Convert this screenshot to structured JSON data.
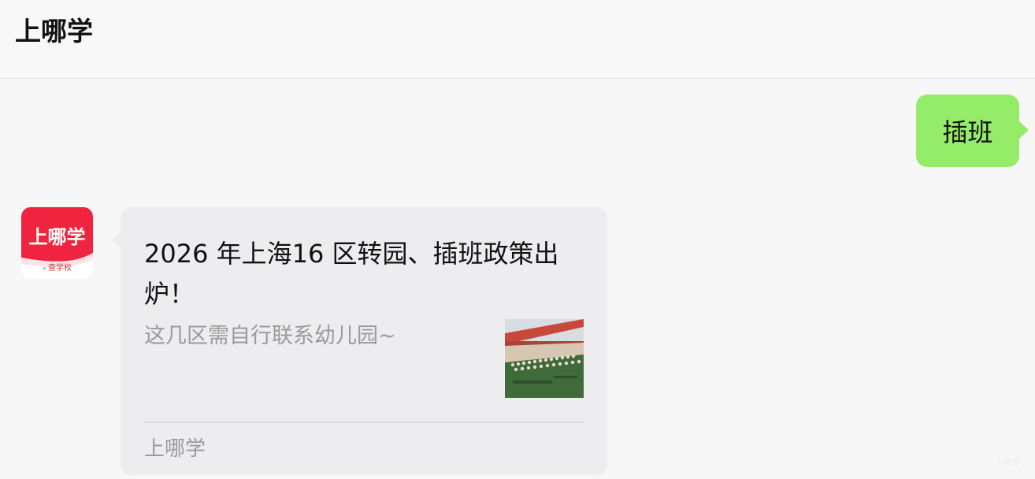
{
  "header": {
    "title": "上哪学"
  },
  "chat": {
    "outgoing": {
      "text": "插班",
      "bubble_color": "#95ec69"
    },
    "incoming": {
      "avatar": {
        "brand_text": "上哪学",
        "sub_label": "查学校",
        "sub_icon": "search-icon",
        "brand_color": "#f0243f"
      },
      "card": {
        "title": "2026 年上海16 区转园、插班政策出炉！",
        "description": "这几区需自行联系幼儿园~",
        "thumbnail": "school-group-photo",
        "source": "上哪学"
      }
    }
  },
  "watermark": "上哪学"
}
